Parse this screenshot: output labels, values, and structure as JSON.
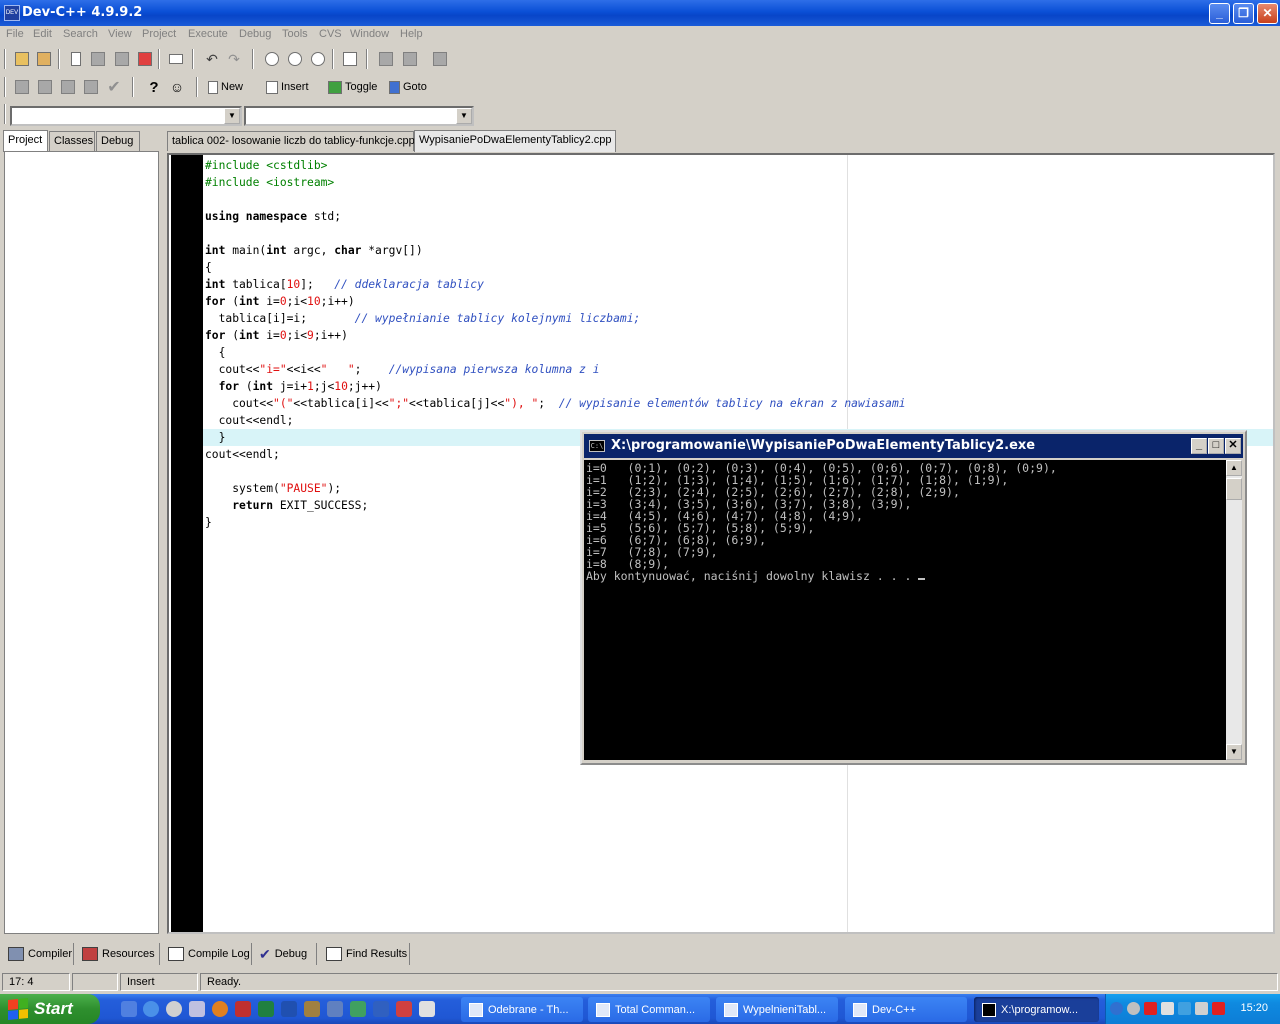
{
  "window": {
    "title": "Dev-C++ 4.9.9.2",
    "icon_label": "DEV"
  },
  "menu": [
    "File",
    "Edit",
    "Search",
    "View",
    "Project",
    "Execute",
    "Debug",
    "Tools",
    "CVS",
    "Window",
    "Help"
  ],
  "toolbar2": {
    "new_label": "New",
    "insert_label": "Insert",
    "toggle_label": "Toggle",
    "goto_label": "Goto"
  },
  "left_tabs": [
    "Project",
    "Classes",
    "Debug"
  ],
  "editor_tabs": [
    "tablica 002- losowanie liczb do tablicy-funkcje.cpp",
    "WypisaniePoDwaElementyTablicy2.cpp"
  ],
  "code_lines": [
    [
      {
        "t": "#include <cstdlib>",
        "c": "pp"
      }
    ],
    [
      {
        "t": "#include <iostream>",
        "c": "pp"
      }
    ],
    [],
    [
      {
        "t": "using namespace",
        "c": "kw"
      },
      {
        "t": " std;"
      }
    ],
    [],
    [
      {
        "t": "int",
        "c": "kw"
      },
      {
        "t": " main("
      },
      {
        "t": "int",
        "c": "kw"
      },
      {
        "t": " argc, "
      },
      {
        "t": "char",
        "c": "kw"
      },
      {
        "t": " *argv[])"
      }
    ],
    [
      {
        "t": "{"
      }
    ],
    [
      {
        "t": "int",
        "c": "kw"
      },
      {
        "t": " tablica["
      },
      {
        "t": "10",
        "c": "num"
      },
      {
        "t": "];   "
      },
      {
        "t": "// ddeklaracja tablicy",
        "c": "cm"
      }
    ],
    [
      {
        "t": "for",
        "c": "kw"
      },
      {
        "t": " ("
      },
      {
        "t": "int",
        "c": "kw"
      },
      {
        "t": " i="
      },
      {
        "t": "0",
        "c": "num"
      },
      {
        "t": ";i<"
      },
      {
        "t": "10",
        "c": "num"
      },
      {
        "t": ";i++)"
      }
    ],
    [
      {
        "t": "  tablica[i]=i;       "
      },
      {
        "t": "// wypełnianie tablicy kolejnymi liczbami;",
        "c": "cm"
      }
    ],
    [
      {
        "t": "for",
        "c": "kw"
      },
      {
        "t": " ("
      },
      {
        "t": "int",
        "c": "kw"
      },
      {
        "t": " i="
      },
      {
        "t": "0",
        "c": "num"
      },
      {
        "t": ";i<"
      },
      {
        "t": "9",
        "c": "num"
      },
      {
        "t": ";i++)"
      }
    ],
    [
      {
        "t": "  {"
      }
    ],
    [
      {
        "t": "  cout<<"
      },
      {
        "t": "\"i=\"",
        "c": "str"
      },
      {
        "t": "<<i<<"
      },
      {
        "t": "\"   \"",
        "c": "str"
      },
      {
        "t": ";    "
      },
      {
        "t": "//wypisana pierwsza kolumna z i",
        "c": "cm"
      }
    ],
    [
      {
        "t": "  "
      },
      {
        "t": "for",
        "c": "kw"
      },
      {
        "t": " ("
      },
      {
        "t": "int",
        "c": "kw"
      },
      {
        "t": " j=i+"
      },
      {
        "t": "1",
        "c": "num"
      },
      {
        "t": ";j<"
      },
      {
        "t": "10",
        "c": "num"
      },
      {
        "t": ";j++)"
      }
    ],
    [
      {
        "t": "    cout<<"
      },
      {
        "t": "\"(\"",
        "c": "str"
      },
      {
        "t": "<<tablica[i]<<"
      },
      {
        "t": "\";\"",
        "c": "str"
      },
      {
        "t": "<<tablica[j]<<"
      },
      {
        "t": "\"), \"",
        "c": "str"
      },
      {
        "t": ";  "
      },
      {
        "t": "// wypisanie elementów tablicy na ekran z nawiasami",
        "c": "cm"
      }
    ],
    [
      {
        "t": "  cout<<endl;"
      }
    ],
    [
      {
        "t": "  }"
      }
    ],
    [
      {
        "t": "cout<<endl;"
      }
    ],
    [],
    [
      {
        "t": "    system("
      },
      {
        "t": "\"PAUSE\"",
        "c": "str"
      },
      {
        "t": ");"
      }
    ],
    [
      {
        "t": "    "
      },
      {
        "t": "return",
        "c": "kw"
      },
      {
        "t": " EXIT_SUCCESS;"
      }
    ],
    [
      {
        "t": "}"
      }
    ]
  ],
  "current_line": 17,
  "bottom_tabs": [
    "Compiler",
    "Resources",
    "Compile Log",
    "Debug",
    "Find Results"
  ],
  "status": {
    "position": "17: 4",
    "mode": "Insert",
    "message": "Ready."
  },
  "console": {
    "title": "X:\\programowanie\\WypisaniePoDwaElementyTablicy2.exe",
    "icon_label": "C:\\",
    "lines": [
      "i=0   (0;1), (0;2), (0;3), (0;4), (0;5), (0;6), (0;7), (0;8), (0;9),",
      "i=1   (1;2), (1;3), (1;4), (1;5), (1;6), (1;7), (1;8), (1;9),",
      "i=2   (2;3), (2;4), (2;5), (2;6), (2;7), (2;8), (2;9),",
      "i=3   (3;4), (3;5), (3;6), (3;7), (3;8), (3;9),",
      "i=4   (4;5), (4;6), (4;7), (4;8), (4;9),",
      "i=5   (5;6), (5;7), (5;8), (5;9),",
      "i=6   (6;7), (6;8), (6;9),",
      "i=7   (7;8), (7;9),",
      "i=8   (8;9),",
      "",
      "Aby kontynuować, naciśnij dowolny klawisz . . . "
    ]
  },
  "taskbar": {
    "start_label": "Start",
    "buttons": [
      "Odebrane - Th...",
      "Total Comman...",
      "WypelnieniTabl...",
      "Dev-C++",
      "X:\\programow..."
    ],
    "clock": "15:20"
  }
}
